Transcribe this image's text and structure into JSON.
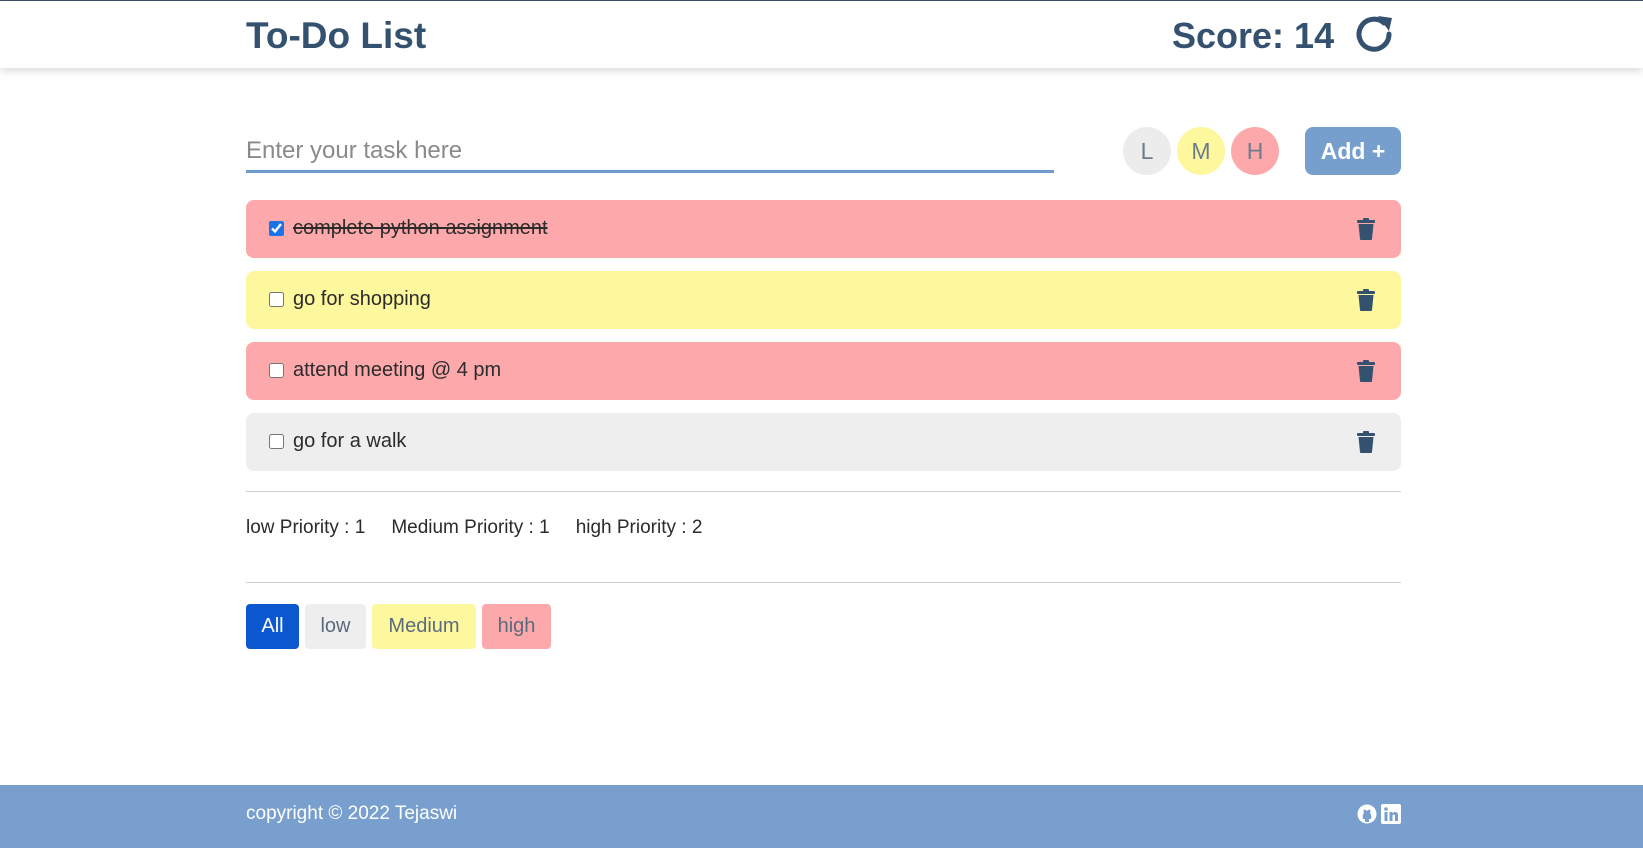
{
  "header": {
    "title": "To-Do List",
    "score_text": "Score: 14",
    "refresh_icon": "refresh-icon"
  },
  "input": {
    "placeholder": "Enter your task here",
    "value": ""
  },
  "priority_buttons": [
    {
      "label": "L",
      "color": "#ececec"
    },
    {
      "label": "M",
      "color": "#fdf79e"
    },
    {
      "label": "H",
      "color": "#fda9ab"
    }
  ],
  "add_button": {
    "label": "Add +"
  },
  "tasks": [
    {
      "text": "complete python assignment",
      "done": true,
      "priority": "high",
      "color": "#fda9ab"
    },
    {
      "text": "go for shopping",
      "done": false,
      "priority": "medium",
      "color": "#fdf79e"
    },
    {
      "text": "attend meeting @ 4 pm",
      "done": false,
      "priority": "high",
      "color": "#fda9ab"
    },
    {
      "text": "go for a walk",
      "done": false,
      "priority": "low",
      "color": "#eeeeee"
    }
  ],
  "counts": {
    "low": "low Priority : 1",
    "medium": "Medium Priority : 1",
    "high": "high Priority : 2"
  },
  "filters": [
    {
      "label": "All",
      "active": true
    },
    {
      "label": "low",
      "active": false
    },
    {
      "label": "Medium",
      "active": false
    },
    {
      "label": "high",
      "active": false
    }
  ],
  "footer": {
    "copyright": "copyright © 2022 Tejaswi",
    "icons": [
      "github-icon",
      "linkedin-icon"
    ]
  },
  "colors": {
    "primary_text": "#34516f",
    "accent": "#779fcd",
    "active_filter": "#0b57d0"
  }
}
